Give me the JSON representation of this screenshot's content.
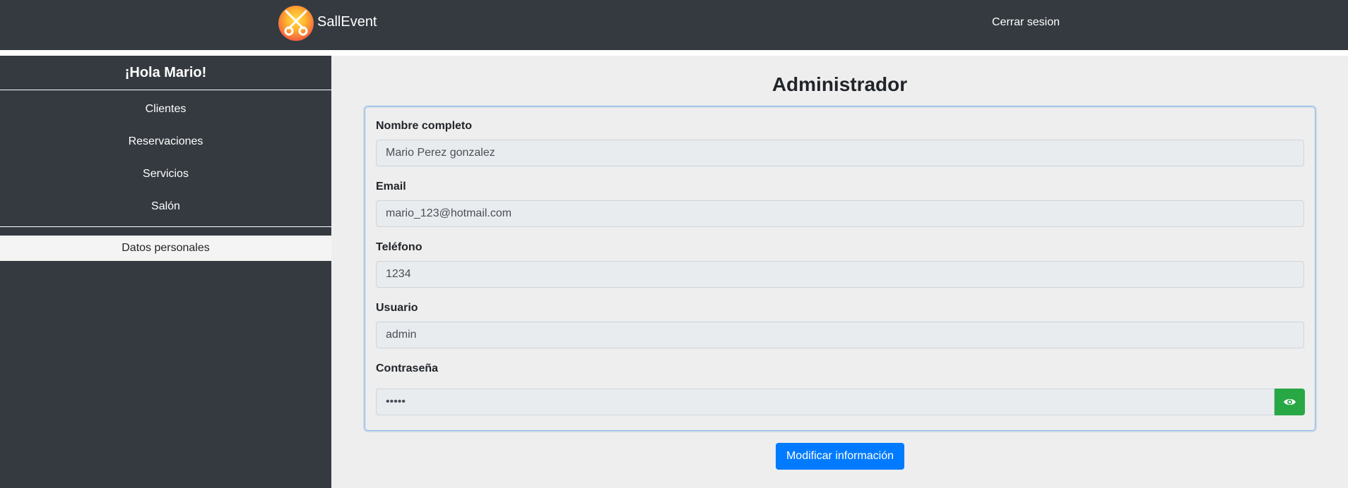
{
  "header": {
    "brand": "SallEvent",
    "logout_label": "Cerrar sesion",
    "logo_icon": "cutlery-logo-icon"
  },
  "sidebar": {
    "greeting": "¡Hola Mario!",
    "items": [
      {
        "label": "Clientes"
      },
      {
        "label": "Reservaciones"
      },
      {
        "label": "Servicios"
      },
      {
        "label": "Salón"
      }
    ],
    "active_item": {
      "label": "Datos personales"
    }
  },
  "main": {
    "title": "Administrador",
    "fields": {
      "name": {
        "label": "Nombre completo",
        "value": "Mario Perez gonzalez"
      },
      "email": {
        "label": "Email",
        "value": "mario_123@hotmail.com"
      },
      "phone": {
        "label": "Teléfono",
        "value": "1234"
      },
      "user": {
        "label": "Usuario",
        "value": "admin"
      },
      "password": {
        "label": "Contraseña",
        "value": "•••••",
        "toggle_icon": "eye-icon"
      }
    },
    "submit_label": "Modificar información"
  },
  "colors": {
    "nav_bg": "#343a40",
    "content_bg": "#eeeeee",
    "primary": "#007bff",
    "success": "#28a745"
  }
}
